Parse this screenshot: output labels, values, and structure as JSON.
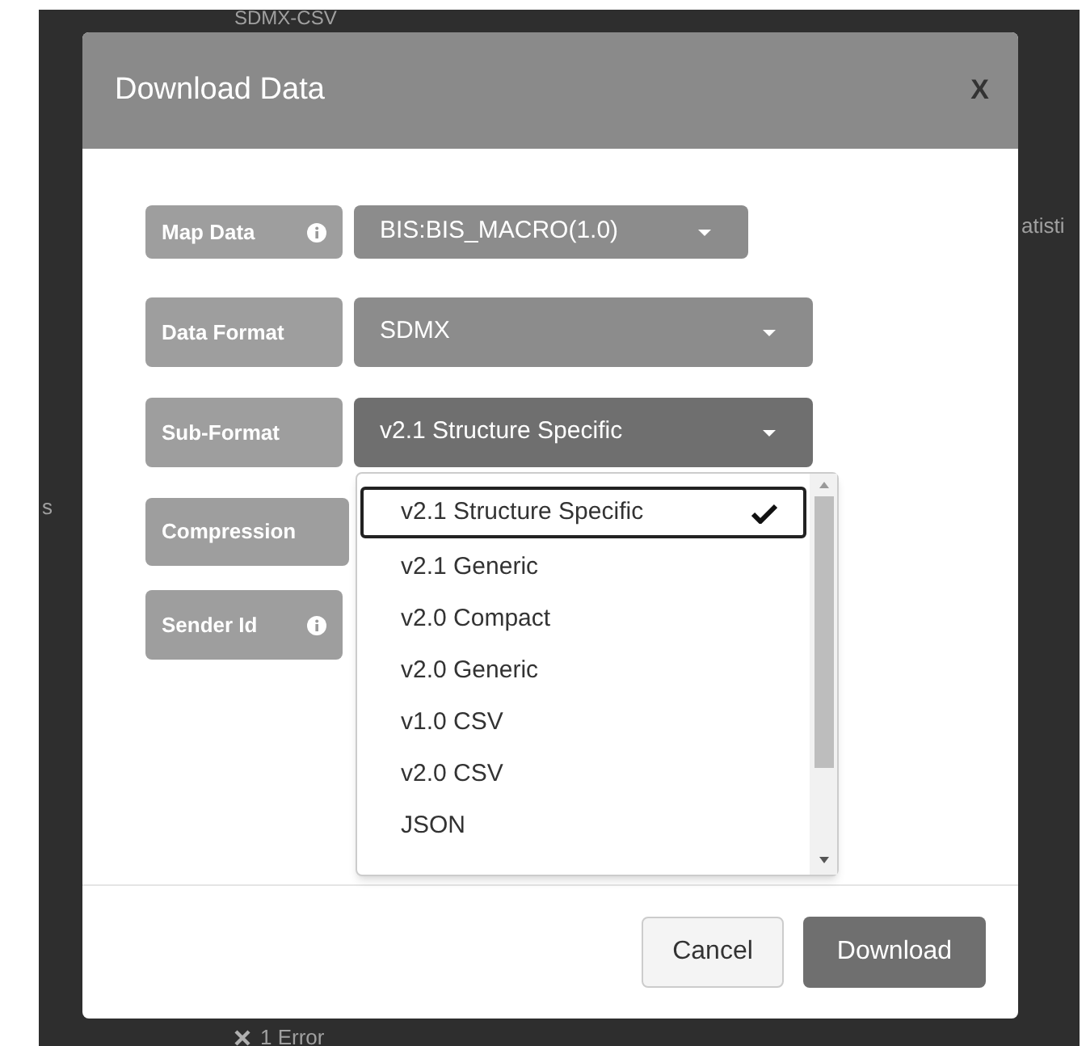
{
  "background": {
    "texts": [
      "SDMX-CSV",
      "atisti",
      "s",
      "1 Error"
    ]
  },
  "dialog": {
    "title": "Download Data",
    "close": "X",
    "fields": [
      {
        "label": "Map Data",
        "info": true,
        "value": "BIS:BIS_MACRO(1.0)",
        "open": false
      },
      {
        "label": "Data Format",
        "info": false,
        "value": "SDMX",
        "open": false
      },
      {
        "label": "Sub-Format",
        "info": false,
        "value": "v2.1 Structure Specific",
        "open": true
      },
      {
        "label": "Compression",
        "info": false
      },
      {
        "label": "Sender Id",
        "info": true
      }
    ],
    "dropdown": {
      "options": [
        {
          "label": "v2.1 Structure Specific",
          "selected": true
        },
        {
          "label": "v2.1 Generic",
          "selected": false
        },
        {
          "label": "v2.0 Compact",
          "selected": false
        },
        {
          "label": "v2.0 Generic",
          "selected": false
        },
        {
          "label": "v1.0 CSV",
          "selected": false
        },
        {
          "label": "v2.0 CSV",
          "selected": false
        },
        {
          "label": "JSON",
          "selected": false
        }
      ]
    },
    "buttons": [
      {
        "label": "Cancel",
        "kind": "secondary"
      },
      {
        "label": "Download",
        "kind": "primary"
      }
    ]
  }
}
